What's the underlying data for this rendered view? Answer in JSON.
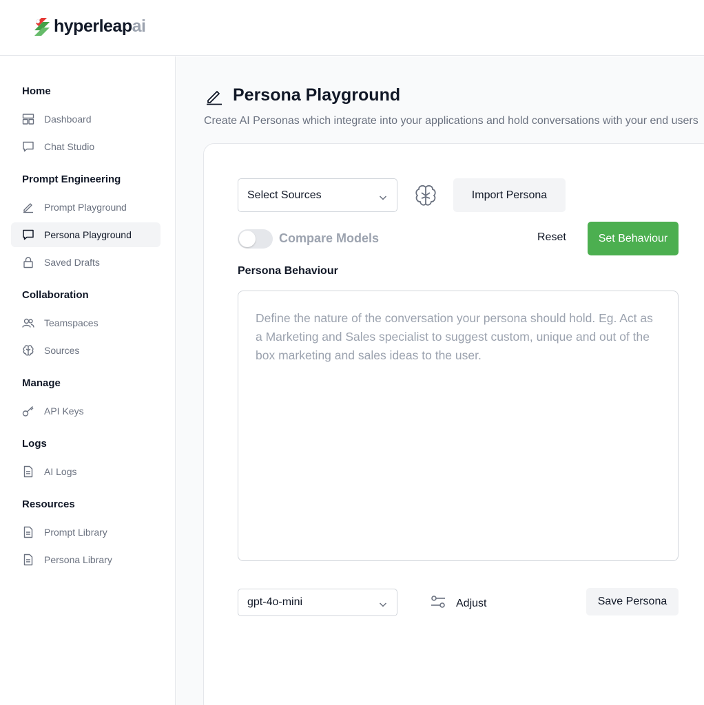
{
  "brand": {
    "name_main": "hyperleap",
    "name_suffix": "ai"
  },
  "sidebar": {
    "sections": [
      {
        "title": "Home",
        "items": [
          {
            "label": "Dashboard",
            "icon": "dashboard-icon"
          },
          {
            "label": "Chat Studio",
            "icon": "chat-icon"
          }
        ]
      },
      {
        "title": "Prompt Engineering",
        "items": [
          {
            "label": "Prompt Playground",
            "icon": "pencil-icon"
          },
          {
            "label": "Persona Playground",
            "icon": "chat-icon",
            "active": true
          },
          {
            "label": "Saved Drafts",
            "icon": "lock-icon"
          }
        ]
      },
      {
        "title": "Collaboration",
        "items": [
          {
            "label": "Teamspaces",
            "icon": "users-icon"
          },
          {
            "label": "Sources",
            "icon": "brain-icon"
          }
        ]
      },
      {
        "title": "Manage",
        "items": [
          {
            "label": "API Keys",
            "icon": "key-icon"
          }
        ]
      },
      {
        "title": "Logs",
        "items": [
          {
            "label": "AI Logs",
            "icon": "document-icon"
          }
        ]
      },
      {
        "title": "Resources",
        "items": [
          {
            "label": "Prompt Library",
            "icon": "document-icon"
          },
          {
            "label": "Persona Library",
            "icon": "document-icon"
          }
        ]
      }
    ]
  },
  "page": {
    "title": "Persona Playground",
    "subtitle": "Create AI Personas which integrate into your applications and hold conversations with your end users"
  },
  "toolbar": {
    "sources_select": "Select Sources",
    "import_label": "Import Persona",
    "compare_label": "Compare Models",
    "compare_enabled": false,
    "reset_label": "Reset",
    "set_behaviour_label": "Set Behaviour"
  },
  "behaviour": {
    "label": "Persona Behaviour",
    "placeholder": "Define the nature of the conversation your persona should hold. Eg. Act as a Marketing and Sales specialist to suggest custom, unique and out of the box marketing and sales ideas to the user."
  },
  "footer": {
    "model_select": "gpt-4o-mini",
    "adjust_label": "Adjust",
    "save_label": "Save Persona"
  },
  "colors": {
    "accent_green": "#4caf50",
    "muted_text": "#6b7280",
    "border": "#e5e7eb"
  }
}
